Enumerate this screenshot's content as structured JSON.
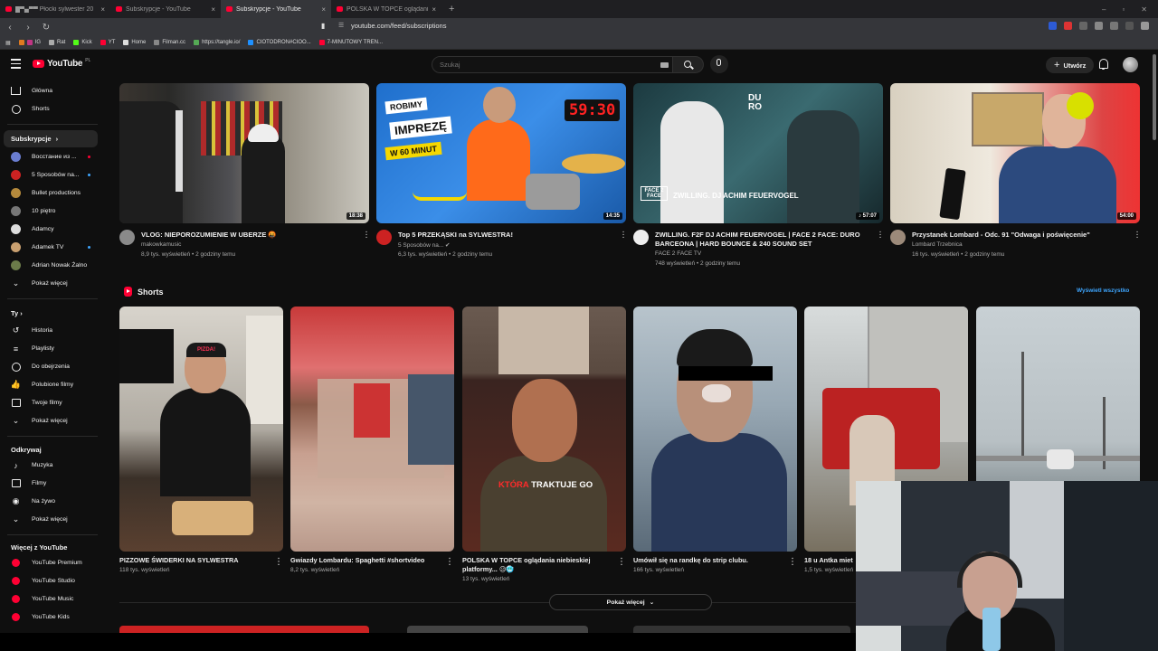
{
  "browser": {
    "tabs": [
      {
        "label": "█▀▄▀▀ Płocki sylwester 20",
        "active": false
      },
      {
        "label": "Subskrypcje - YouTube",
        "active": false
      },
      {
        "label": "Subskrypcje - YouTube",
        "active": true
      },
      {
        "label": "POLSKA W TOPCE oglądania niebie",
        "active": false
      }
    ],
    "url": "youtube.com/feed/subscriptions",
    "bookmarks": [
      "IG",
      "Rat",
      "Kick",
      "YT",
      "Home",
      "Filman.cc",
      "https://tangle.io/",
      "CIOTODRON#CIOO...",
      "7-MINUTOWY TREN..."
    ]
  },
  "header": {
    "logo_text": "YouTube",
    "logo_country": "PL",
    "search_placeholder": "Szukaj",
    "create_label": "Utwórz"
  },
  "sidebar": {
    "main": [
      {
        "label": "Główna",
        "icon": "home-icon"
      },
      {
        "label": "Shorts",
        "icon": "shorts-icon"
      }
    ],
    "subscriptions_heading": "Subskrypcje",
    "subscriptions": [
      {
        "label": "Восстание из ...",
        "color": "#6a7dd0",
        "live": true
      },
      {
        "label": "5 Sposobów na...",
        "color": "#c22",
        "live": true
      },
      {
        "label": "Bullet productions",
        "color": "#b58a3c",
        "live": false
      },
      {
        "label": "10 piętro",
        "color": "#777",
        "live": false
      },
      {
        "label": "Adamcy",
        "color": "#ddd",
        "live": false
      },
      {
        "label": "Adamek TV",
        "color": "#c9a070",
        "live": true
      },
      {
        "label": "Adrian Nowak Żalno",
        "color": "#6b7b4a",
        "live": false
      }
    ],
    "show_more": "Pokaż więcej",
    "you_heading": "Ty",
    "you_items": [
      "Historia",
      "Playlisty",
      "Do obejrzenia",
      "Polubione filmy",
      "Twoje filmy",
      "Pokaż więcej"
    ],
    "explore_heading": "Odkrywaj",
    "explore_items": [
      "Muzyka",
      "Filmy",
      "Na żywo",
      "Pokaż więcej"
    ],
    "more_heading": "Więcej z YouTube",
    "more_items": [
      "YouTube Premium",
      "YouTube Studio",
      "YouTube Music",
      "YouTube Kids"
    ]
  },
  "videos": [
    {
      "title": "VLOG: NIEPOROZUMIENIE W UBERZE 🤬",
      "channel": "makowkamusic",
      "meta": "8,9 tys. wyświetleń • 2 godziny temu",
      "duration": "18:38",
      "avatar_color": "#8a8a8a"
    },
    {
      "title": "Top 5 PRZEKĄSKI na SYLWESTRA!",
      "channel": "5 Sposobów na... ✔",
      "meta": "6,3 tys. wyświetleń • 2 godziny temu",
      "duration": "14:35",
      "avatar_color": "#c22"
    },
    {
      "title": "ZWILLING. F2F DJ ACHIM FEUERVOGEL | FACE 2 FACE: DURO BARCEONA | HARD BOUNCE & 240 SOUND SET",
      "channel": "FACE 2 FACE TV",
      "meta": "748 wyświetleń • 2 godziny temu",
      "duration": "♪ 57:07",
      "avatar_color": "#eee"
    },
    {
      "title": "Przystanek Lombard - Odc. 91 \"Odwaga i poświęcenie\"",
      "channel": "Lombard Trzebnica",
      "meta": "16 tys. wyświetleń • 2 godziny temu",
      "duration": "54:00",
      "avatar_color": "#9c8a7a"
    }
  ],
  "thumb_text": {
    "v2_line1": "ROBIMY",
    "v2_line2": "IMPREZĘ",
    "v2_line3": "W 60 MINUT",
    "v2_timer": "59:30",
    "v3_logo": "DU RO",
    "v3_caption": "ZWILLING. DJ ACHIM FEUERVOGEL",
    "v3_badge": "FACE 2 FACE",
    "short1_cap": "PIZDA!",
    "short3_cap_red": "KTÓRA",
    "short3_cap_white": "TRAKTUJE GO"
  },
  "shorts_section": {
    "title": "Shorts",
    "view_all": "Wyświetl wszystko",
    "items": [
      {
        "title": "PIZZOWE ŚWIDERKI NA SYLWESTRA",
        "views": "118 tys. wyświetleń"
      },
      {
        "title": "Gwiazdy Lombardu: Spaghetti #shortvideo",
        "views": "8,2 tys. wyświetleń"
      },
      {
        "title": "POLSKA W TOPCE oglądania niebieskiej platformy... 😥🥶",
        "views": "13 tys. wyświetleń"
      },
      {
        "title": "Umówił się na randkę do strip clubu.",
        "views": "166 tys. wyświetleń"
      },
      {
        "title": "18 u Antka miet",
        "views": "1,5 tys. wyświetleń"
      },
      {
        "title": "",
        "views": ""
      }
    ],
    "show_more": "Pokaż więcej"
  },
  "colors": {
    "bg": "#0f0f0f",
    "accent_red": "#ff0033",
    "link_blue": "#3ea6ff",
    "text_secondary": "#aaaaaa"
  }
}
